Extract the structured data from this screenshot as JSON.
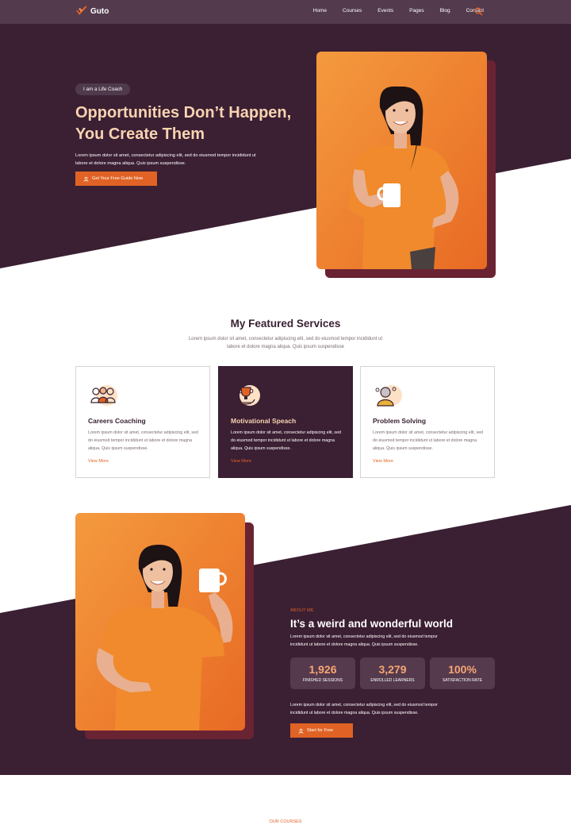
{
  "brand": {
    "name": "Guto",
    "accent": "#e06325",
    "dark": "#3b1f33",
    "header_bg": "#533a4d",
    "peach": "#f7d3b1"
  },
  "nav": {
    "items": [
      {
        "label": "Home"
      },
      {
        "label": "Courses"
      },
      {
        "label": "Events"
      },
      {
        "label": "Pages"
      },
      {
        "label": "Blog"
      },
      {
        "label": "Contact"
      }
    ],
    "search_icon": "search-icon"
  },
  "hero": {
    "badge": "I am a Life Coach",
    "title": "Opportunities Don’t Happen, You Create Them",
    "description": "Lorem ipsum dolor sit amet, consectetur adipiscing elit, sed do eiusmod tempor incididunt ut labore et dolore magna aliqua. Quis ipsum suspendisse.",
    "button_label": "Get Your Free Guide Now",
    "button_icon": "user-icon"
  },
  "services": {
    "title": "My Featured Services",
    "subtitle": "Lorem ipsum dolor sit amet, consectetur adipiscing elit, sed do eiusmod tempor incididunt ut labore et dolore magna aliqua. Quis ipsum suspendisse",
    "cards": [
      {
        "icon": "team-icon",
        "title": "Careers Coaching",
        "text": "Lorem ipsum dolor sit amet, consectetur adipiscing elit, sed do eiusmod tempor incididunt ut labore et dolore magna aliqua. Quis ipsum suspendisse.",
        "link": "View More"
      },
      {
        "icon": "trophy-icon",
        "title": "Motivational Speach",
        "text": "Lorem ipsum dolor sit amet, consectetur adipiscing elit, sed do eiusmod tempor incididunt ut labore et dolore magna aliqua. Quis ipsum suspendisse.",
        "link": "View More"
      },
      {
        "icon": "thinking-person-icon",
        "title": "Problem Solving",
        "text": "Lorem ipsum dolor sit amet, consectetur adipiscing elit, sed do eiusmod tempor incididunt ut labore et dolore magna aliqua. Quis ipsum suspendisse.",
        "link": "View More"
      }
    ]
  },
  "about": {
    "kicker": "ABOUT ME",
    "title": "It’s a weird and wonderful world",
    "description": "Lorem ipsum dolor sit amet, consectetur adipiscing elit, sed do eiusmod tempor incididunt ut labore et dolore magna aliqua. Quis ipsum suspendisse.",
    "stats": [
      {
        "value": "1,926",
        "label": "FINISHED SESSIONS"
      },
      {
        "value": "3,279",
        "label": "ENROLLED LEARNERS"
      },
      {
        "value": "100%",
        "label": "SATISFACTION RATE"
      }
    ],
    "description2": "Lorem ipsum dolor sit amet, consectetur adipiscing elit, sed do eiusmod tempor incididunt ut labore et dolore magna aliqua. Quis ipsum suspendisse.",
    "button_label": "Start for Free",
    "button_icon": "user-icon"
  },
  "courses": {
    "kicker": "OUR COURSES"
  }
}
